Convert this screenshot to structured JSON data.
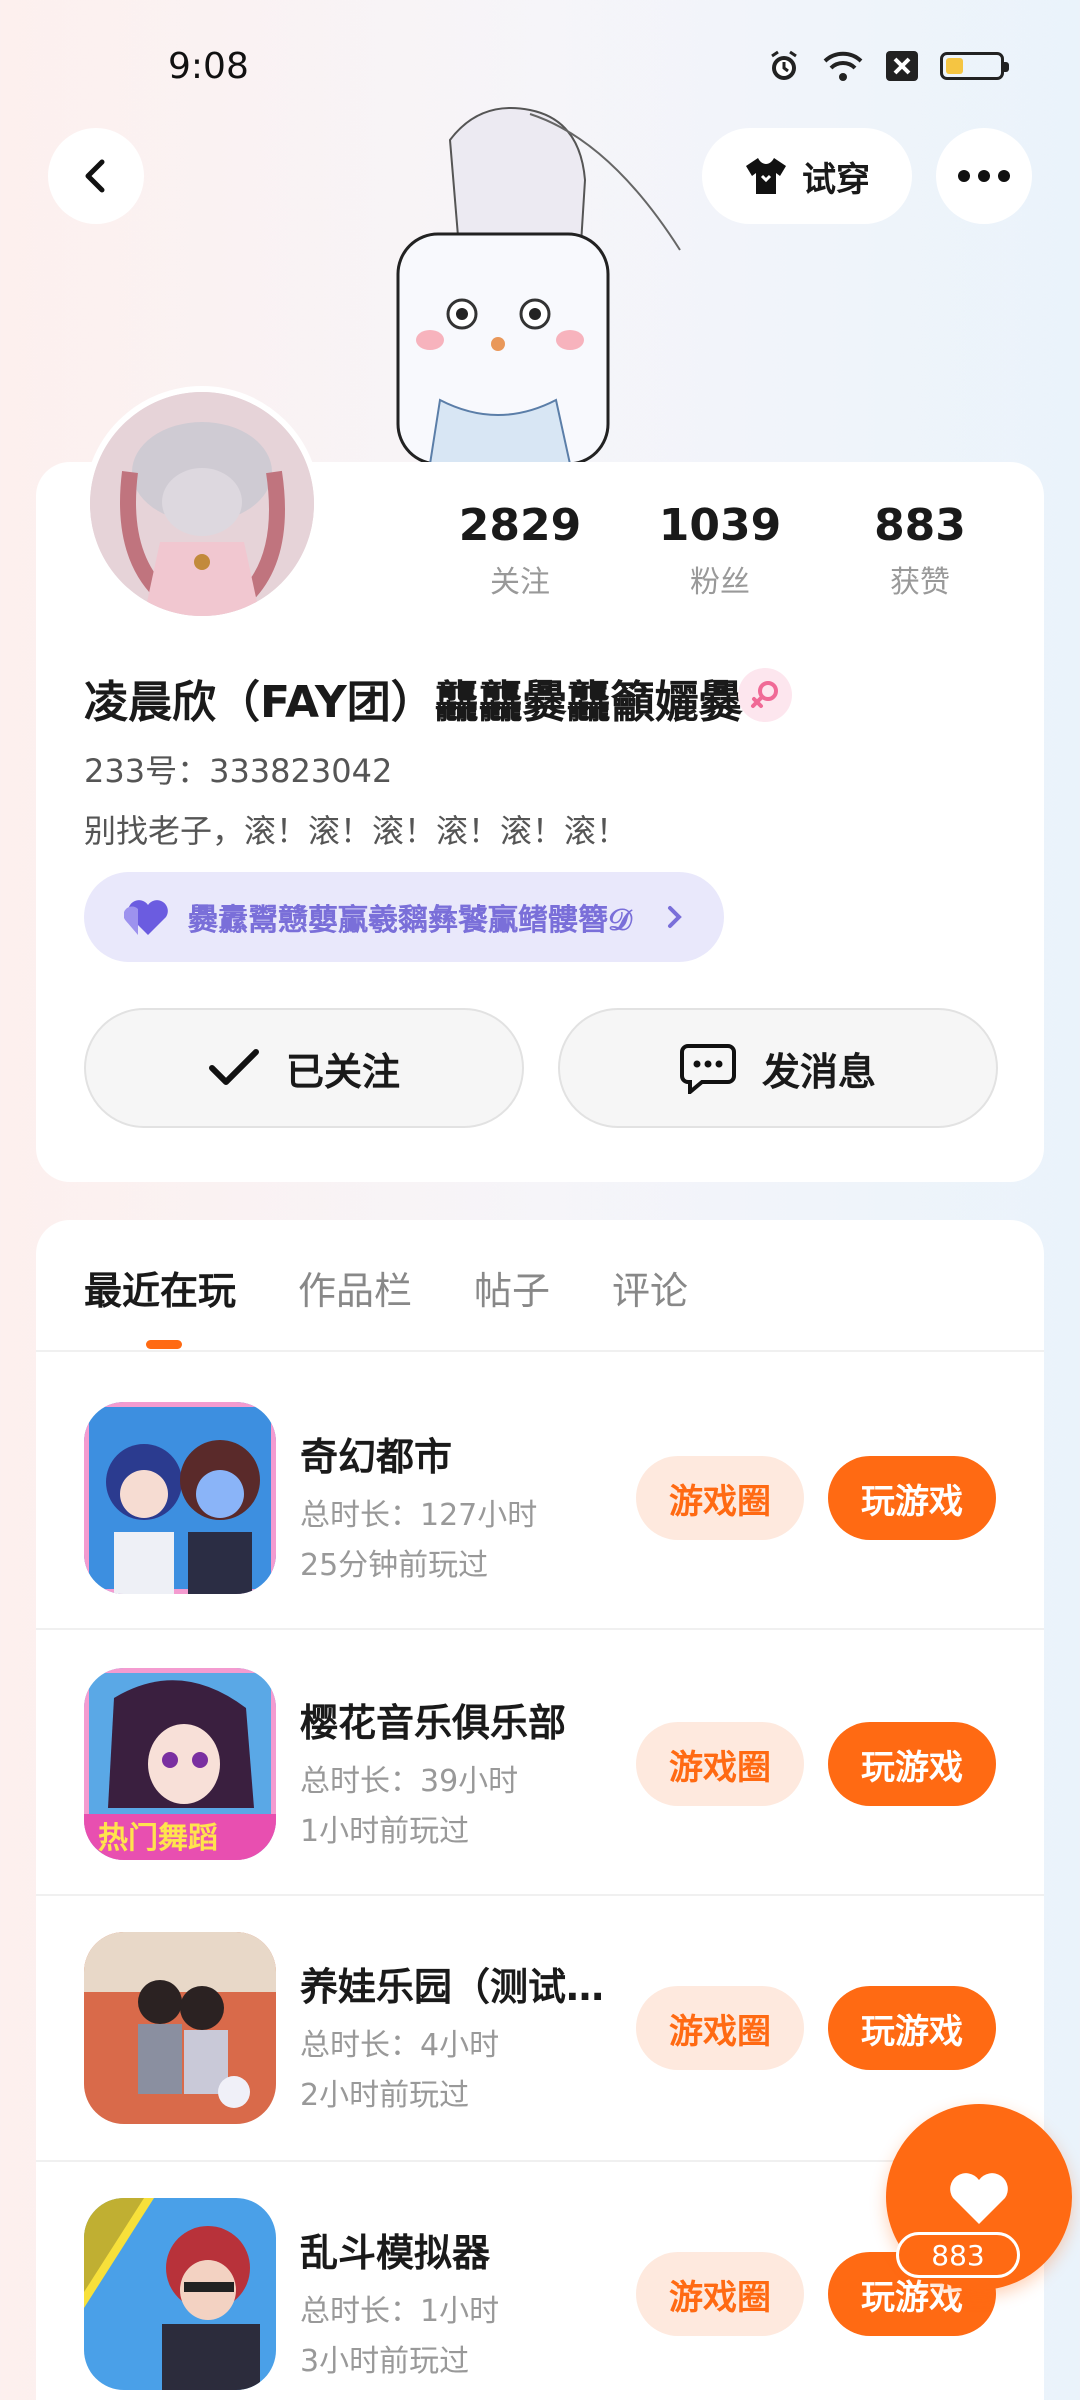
{
  "status_bar": {
    "time": "9:08"
  },
  "header": {
    "tryon_label": "试穿"
  },
  "profile": {
    "stats": [
      {
        "value": "2829",
        "label": "关注"
      },
      {
        "value": "1039",
        "label": "粉丝"
      },
      {
        "value": "883",
        "label": "获赞"
      }
    ],
    "nickname": "凌晨欣（FAY团）龘龘爨龘籲孋爨",
    "uid": "233号：333823042",
    "bio": "别找老子，滚！滚！滚！滚！滚！滚！",
    "tag": "爨纛鬻戆蘡鸁羲黐彝饕鸁鳍髏簪𝒟",
    "follow_label": "已关注",
    "message_label": "发消息"
  },
  "tabs": [
    "最近在玩",
    "作品栏",
    "帖子",
    "评论"
  ],
  "games": [
    {
      "name": "奇幻都市",
      "total": "总时长：127小时",
      "last": "25分钟前玩过",
      "circle_label": "游戏圈",
      "play_label": "玩游戏"
    },
    {
      "name": "樱花音乐俱乐部",
      "total": "总时长：39小时",
      "last": "1小时前玩过",
      "circle_label": "游戏圈",
      "play_label": "玩游戏"
    },
    {
      "name": "养娃乐园（测试…",
      "total": "总时长：4小时",
      "last": "2小时前玩过",
      "circle_label": "游戏圈",
      "play_label": "玩游戏"
    },
    {
      "name": "乱斗模拟器",
      "total": "总时长：1小时",
      "last": "3小时前玩过",
      "circle_label": "游戏圈",
      "play_label": "玩游戏"
    }
  ],
  "like_fab": {
    "count": "883"
  },
  "colors": {
    "accent": "#ff6a13",
    "accent_light": "#fee9de",
    "tag_bg": "#e9e8fb",
    "tag_text": "#7a6fd9"
  }
}
